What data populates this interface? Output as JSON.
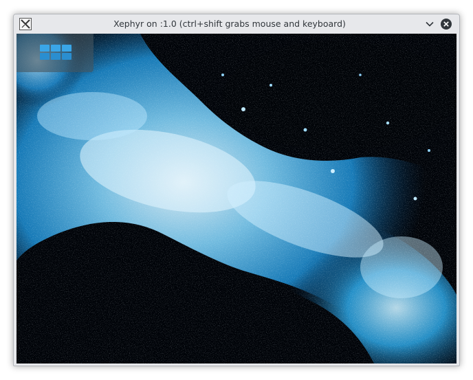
{
  "window": {
    "title": "Xephyr on :1.0 (ctrl+shift grabs mouse and keyboard)",
    "app_icon": "x-window-icon",
    "controls": {
      "minimize_icon": "chevron-down-icon",
      "close_icon": "close-circle-icon"
    }
  },
  "desktop": {
    "wallpaper": "blue water splash on black",
    "launcher_icon": "app-grid-icon"
  },
  "colors": {
    "titlebar": "#e7e8eb",
    "title_text": "#31363b",
    "splash_light": "#d8f3ff",
    "splash_mid": "#29a9e8",
    "splash_dark": "#0b4f8c",
    "background": "#000308"
  }
}
